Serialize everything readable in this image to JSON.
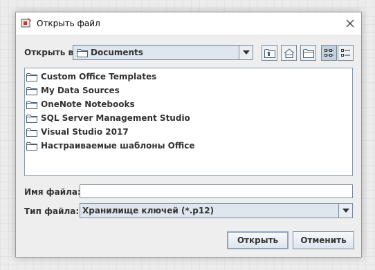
{
  "window": {
    "title": "Открыть файл"
  },
  "lookin": {
    "label": "Открыть в:",
    "value": "Documents"
  },
  "toolbar": {
    "buttons": [
      "up-folder",
      "home",
      "new-folder",
      "list-view",
      "details-view"
    ],
    "active": "list-view"
  },
  "files": [
    {
      "name": "Custom Office Templates"
    },
    {
      "name": "My Data Sources"
    },
    {
      "name": "OneNote Notebooks"
    },
    {
      "name": "SQL Server Management Studio"
    },
    {
      "name": "Visual Studio 2017"
    },
    {
      "name": "Настраиваемые шаблоны Office"
    }
  ],
  "filename": {
    "label": "Имя файла:",
    "value": ""
  },
  "filetype": {
    "label": "Тип файла:",
    "value": "Хранилище ключей (*.p12)"
  },
  "buttons": {
    "open": "Открыть",
    "cancel": "Отменить"
  },
  "colors": {
    "folder_outline": "#4a5d73",
    "selected_button": "#c3d0de",
    "combo_bg": "#dfe6ee"
  }
}
